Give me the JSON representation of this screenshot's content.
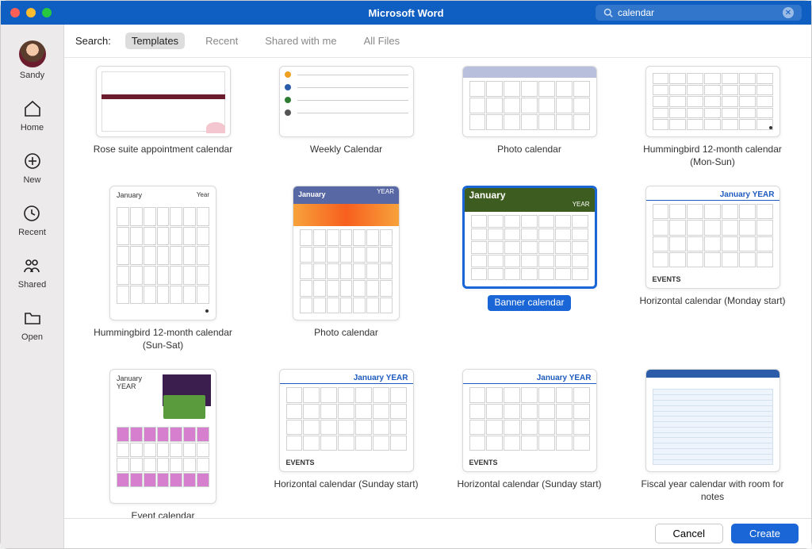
{
  "titlebar": {
    "title": "Microsoft Word",
    "search_value": "calendar"
  },
  "sidebar": {
    "user_name": "Sandy",
    "items": [
      {
        "label": "Home"
      },
      {
        "label": "New"
      },
      {
        "label": "Recent"
      },
      {
        "label": "Shared"
      },
      {
        "label": "Open"
      }
    ]
  },
  "tabs": {
    "label": "Search:",
    "items": [
      {
        "label": "Templates",
        "active": true
      },
      {
        "label": "Recent"
      },
      {
        "label": "Shared with me"
      },
      {
        "label": "All Files"
      }
    ]
  },
  "gallery": [
    {
      "caption": "Rose suite appointment calendar",
      "style": "rose",
      "tall": false,
      "short": true
    },
    {
      "caption": "Weekly Calendar",
      "style": "weekly",
      "tall": false,
      "short": true
    },
    {
      "caption": "Photo calendar",
      "style": "photo-small",
      "tall": false,
      "short": true
    },
    {
      "caption": "Hummingbird 12-month calendar (Mon-Sun)",
      "style": "humming-mon",
      "tall": false,
      "short": true
    },
    {
      "caption": "Hummingbird 12-month calendar (Sun-Sat)",
      "style": "humming-sun",
      "tall": true,
      "short": false
    },
    {
      "caption": "Photo calendar",
      "style": "photo-tall",
      "tall": true,
      "short": false
    },
    {
      "caption": "Banner calendar",
      "style": "banner",
      "tall": false,
      "short": false,
      "selected": true
    },
    {
      "caption": "Horizontal calendar (Monday start)",
      "style": "horiz-mon",
      "tall": false,
      "short": false
    },
    {
      "caption": "Event calendar",
      "style": "event",
      "tall": true,
      "short": false
    },
    {
      "caption": "Horizontal calendar (Sunday start)",
      "style": "horiz-sun",
      "tall": false,
      "short": false
    },
    {
      "caption": "Horizontal calendar (Sunday start)",
      "style": "horiz-sun",
      "tall": false,
      "short": false
    },
    {
      "caption": "Fiscal year calendar with room for notes",
      "style": "fiscal",
      "tall": false,
      "short": false
    }
  ],
  "thumb_labels": {
    "january": "January",
    "year": "YEAR",
    "january_year": "January YEAR",
    "events": "EVENTS"
  },
  "footer": {
    "cancel": "Cancel",
    "create": "Create"
  },
  "colors": {
    "accent": "#1a66d6",
    "titlebar": "#0f5ec2"
  }
}
